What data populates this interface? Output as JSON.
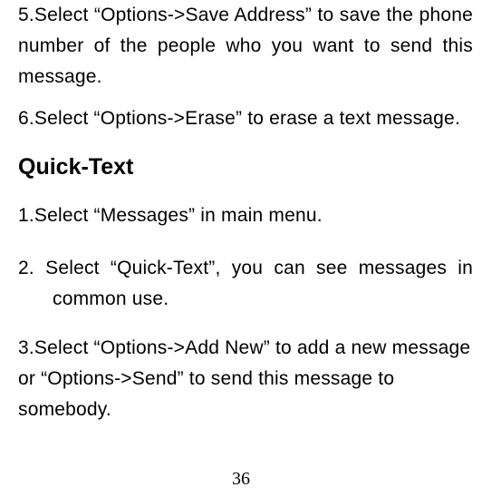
{
  "paragraphs": {
    "p5": "5.Select “Options->Save Address” to save the phone number of the people who you want to send this message.",
    "p6": "6.Select “Options->Erase” to erase a text message.",
    "heading": "Quick-Text",
    "q1": "1.Select “Messages” in main menu.",
    "q2": "2. Select “Quick-Text”, you can see messages in common use.",
    "q3": "3.Select “Options->Add New” to add a new message or “Options->Send” to send this message to somebody."
  },
  "page_number": "36"
}
